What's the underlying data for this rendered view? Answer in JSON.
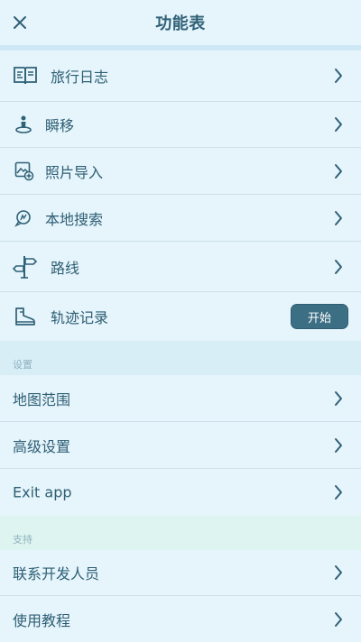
{
  "header": {
    "title": "功能表",
    "close_icon": "close-icon"
  },
  "main_menu": {
    "items": [
      {
        "label": "旅行日志",
        "icon": "journal-book-icon",
        "action": "chevron"
      },
      {
        "label": "瞬移",
        "icon": "teleport-person-icon",
        "action": "chevron"
      },
      {
        "label": "照片导入",
        "icon": "photo-import-icon",
        "action": "chevron"
      },
      {
        "label": "本地搜索",
        "icon": "local-search-icon",
        "action": "chevron"
      },
      {
        "label": "路线",
        "icon": "signpost-icon",
        "action": "chevron"
      },
      {
        "label": "轨迹记录",
        "icon": "boot-icon",
        "action": "button",
        "button_label": "开始"
      }
    ]
  },
  "settings_section": {
    "title": "设置",
    "items": [
      {
        "label": "地图范围"
      },
      {
        "label": "高级设置"
      },
      {
        "label": "Exit app"
      }
    ]
  },
  "support_section": {
    "title": "支持",
    "items": [
      {
        "label": "联系开发人员"
      },
      {
        "label": "使用教程"
      }
    ]
  },
  "colors": {
    "background": "#e6f4fb",
    "text": "#2d5f74",
    "divider": "#cbe0ea",
    "button": "#3c6f84",
    "settings_header_bg": "#d7eef7",
    "support_header_bg": "#ddf4f0"
  }
}
